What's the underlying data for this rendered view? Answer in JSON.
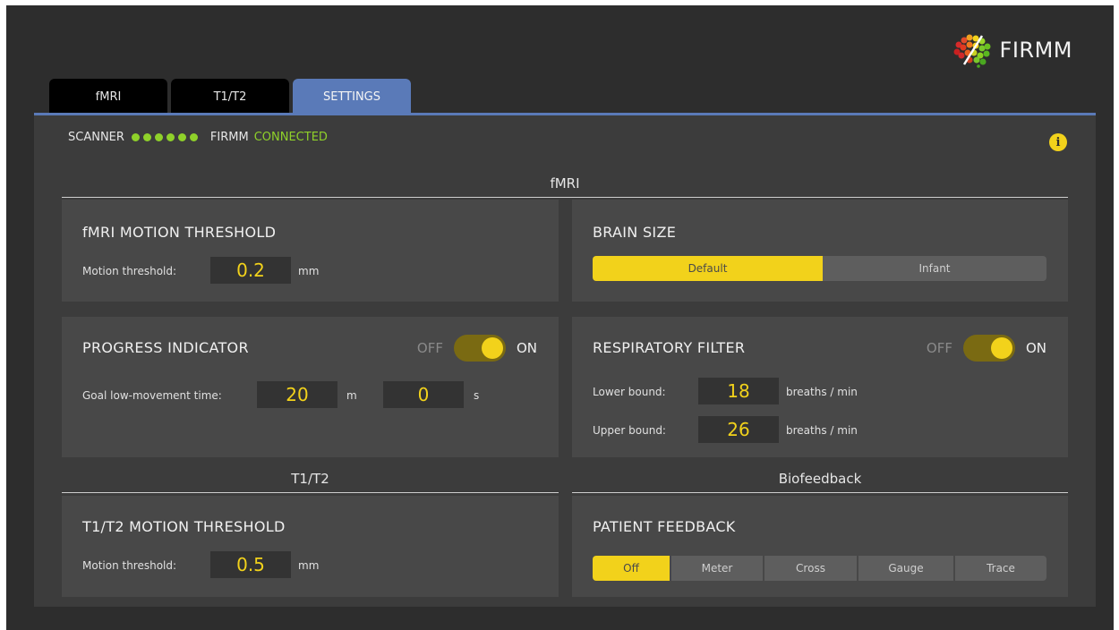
{
  "brand": {
    "name": "FIRMM",
    "logo_icon": "firmm-brain-logo-icon"
  },
  "tabs": [
    {
      "label": "fMRI",
      "active": false
    },
    {
      "label": "T1/T2",
      "active": false
    },
    {
      "label": "SETTINGS",
      "active": true
    }
  ],
  "status": {
    "scanner_label": "SCANNER",
    "scanner_dots": 6,
    "firmm_label": "FIRMM",
    "connection": "CONNECTED",
    "info_icon": "info-icon",
    "info_glyph": "i"
  },
  "sections": {
    "fmri": "fMRI",
    "t1t2": "T1/T2",
    "biofeedback": "Biofeedback"
  },
  "fmri_motion": {
    "title": "fMRI MOTION THRESHOLD",
    "label": "Motion threshold:",
    "value": "0.2",
    "unit": "mm"
  },
  "brain_size": {
    "title": "BRAIN SIZE",
    "options": [
      "Default",
      "Infant"
    ],
    "selected": "Default"
  },
  "progress": {
    "title": "PROGRESS INDICATOR",
    "off_label": "OFF",
    "on_label": "ON",
    "enabled": true,
    "goal_label": "Goal low-movement time:",
    "minutes": "20",
    "minutes_unit": "m",
    "seconds": "0",
    "seconds_unit": "s"
  },
  "respiratory": {
    "title": "RESPIRATORY FILTER",
    "off_label": "OFF",
    "on_label": "ON",
    "enabled": true,
    "lower_label": "Lower bound:",
    "lower_value": "18",
    "upper_label": "Upper bound:",
    "upper_value": "26",
    "unit": "breaths / min"
  },
  "t1t2_motion": {
    "title": "T1/T2 MOTION THRESHOLD",
    "label": "Motion threshold:",
    "value": "0.5",
    "unit": "mm"
  },
  "patient_feedback": {
    "title": "PATIENT FEEDBACK",
    "options": [
      "Off",
      "Meter",
      "Cross",
      "Gauge",
      "Trace"
    ],
    "selected": "Off"
  },
  "colors": {
    "accent_yellow": "#f2d21b",
    "tab_blue": "#5a7ab8",
    "status_green": "#8fd12a"
  }
}
